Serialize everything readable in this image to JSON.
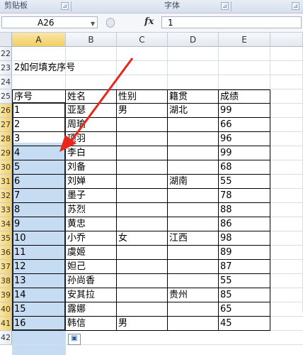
{
  "ribbon": {
    "groups": [
      {
        "label": "剪贴板",
        "launcher": "⊿"
      },
      {
        "label": "字体",
        "launcher": "⊿"
      },
      {
        "label": "",
        "launcher": "⊿"
      }
    ]
  },
  "formula_bar": {
    "name_box": "A26",
    "fx_label": "fx",
    "value": "1"
  },
  "columns": [
    "A",
    "B",
    "C",
    "D",
    "E"
  ],
  "selected_column": "A",
  "rows": [
    "22",
    "23",
    "24",
    "25",
    "26",
    "27",
    "28",
    "29",
    "30",
    "31",
    "32",
    "33",
    "34",
    "35",
    "36",
    "37",
    "38",
    "39",
    "40",
    "41",
    "42"
  ],
  "selected_rows": [
    "26",
    "27",
    "28",
    "29",
    "30",
    "31",
    "32",
    "33",
    "34",
    "35",
    "36",
    "37",
    "38",
    "39",
    "40",
    "41"
  ],
  "sheet": {
    "title": "2如何填充序号",
    "headers": [
      "序号",
      "姓名",
      "性别",
      "籍贯",
      "成绩"
    ],
    "table": [
      [
        "1",
        "亚瑟",
        "男",
        "湖北",
        "99"
      ],
      [
        "2",
        "周瑜",
        "",
        "",
        "66"
      ],
      [
        "3",
        "项羽",
        "",
        "",
        "96"
      ],
      [
        "4",
        "李白",
        "",
        "",
        "99"
      ],
      [
        "5",
        "刘备",
        "",
        "",
        "68"
      ],
      [
        "6",
        "刘婵",
        "",
        "湖南",
        "55"
      ],
      [
        "7",
        "墨子",
        "",
        "",
        "78"
      ],
      [
        "8",
        "苏烈",
        "",
        "",
        "88"
      ],
      [
        "9",
        "黄忠",
        "",
        "",
        "86"
      ],
      [
        "10",
        "小乔",
        "女",
        "江西",
        "98"
      ],
      [
        "11",
        "虞姬",
        "",
        "",
        "89"
      ],
      [
        "12",
        "妲己",
        "",
        "",
        "87"
      ],
      [
        "13",
        "孙尚香",
        "",
        "",
        "55"
      ],
      [
        "14",
        "安其拉",
        "",
        "贵州",
        "85"
      ],
      [
        "15",
        "露娜",
        "",
        "",
        "65"
      ],
      [
        "16",
        "韩信",
        "男",
        "",
        "45"
      ]
    ]
  },
  "paste_options_icon": "paste-options-icon",
  "annotation_color": "#e8261c",
  "selection_color": "#c5dcf3"
}
